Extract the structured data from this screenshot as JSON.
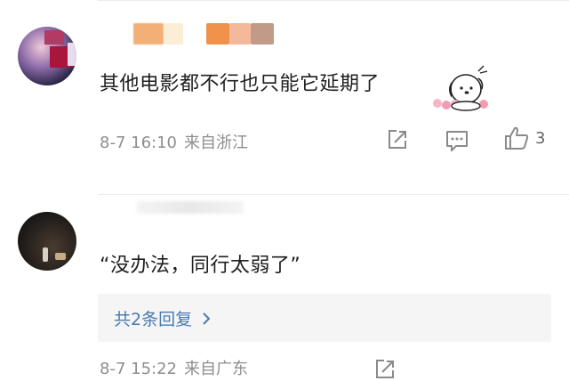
{
  "comments": [
    {
      "text": "其他电影都不行也只能它延期了",
      "date": "8-7 16:10",
      "location": "来自浙江",
      "likes": "3",
      "icons": {
        "share": "share-icon",
        "reply": "comment-icon",
        "like": "thumb-up-icon"
      }
    },
    {
      "text": "“没办法，同行太弱了”",
      "replies_label": "共2条回复",
      "date": "8-7 15:22",
      "location": "来自广东",
      "icons": {
        "share": "share-icon",
        "chevron": "chevron-right-icon"
      }
    }
  ],
  "colors": {
    "meta_gray": "#8e8e8e",
    "link_blue": "#4a7ab0",
    "reply_bg": "#f5f5f5"
  }
}
